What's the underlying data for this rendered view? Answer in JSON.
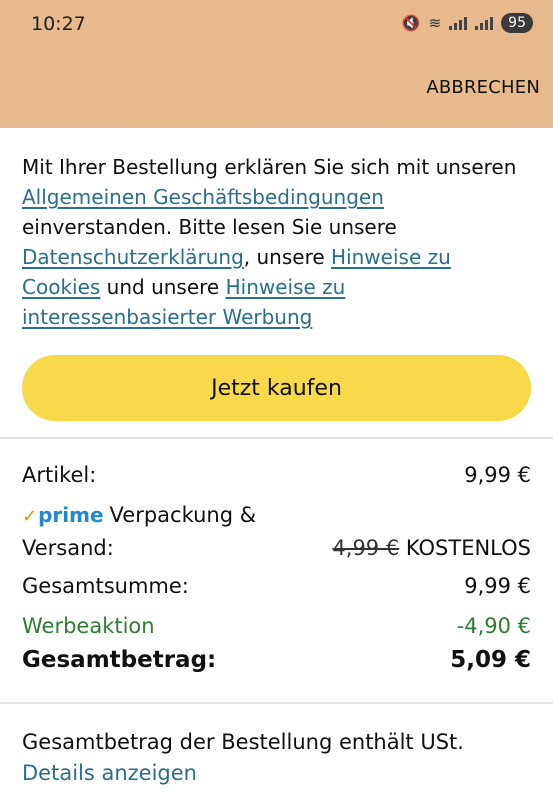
{
  "status_bar": {
    "time": "10:27",
    "battery": "95"
  },
  "header": {
    "cancel_label": "ABBRECHEN"
  },
  "legal": {
    "text1": "Mit Ihrer Bestellung erklären Sie sich mit unseren ",
    "link_terms": "Allgemeinen Geschäftsbedingungen",
    "text2": " einverstanden. Bitte lesen Sie unsere ",
    "link_privacy": "Datenschutzerklärung",
    "text3": ", unsere ",
    "link_cookies": "Hinweise zu Cookies",
    "text4": " und unsere ",
    "link_ads": "Hinweise zu interessenbasierter Werbung"
  },
  "buy_button": {
    "label": "Jetzt kaufen"
  },
  "summary": {
    "items_label": "Artikel:",
    "items_value": "9,99 €",
    "prime_label": "prime",
    "shipping_label_line1": "Verpackung &",
    "shipping_label_line2": "Versand:",
    "shipping_old": "4,99 €",
    "shipping_new": "KOSTENLOS",
    "subtotal_label": "Gesamtsumme:",
    "subtotal_value": "9,99 €",
    "promo_label": "Werbeaktion",
    "promo_value": "-4,90 €",
    "total_label": "Gesamtbetrag:",
    "total_value": "5,09 €"
  },
  "footer": {
    "vat_note": "Gesamtbetrag der Bestellung enthält USt.",
    "details_link": "Details anzeigen"
  },
  "colors": {
    "header_bg": "#e7b98c",
    "button_bg": "#f8d94a",
    "link": "#2a6f8c",
    "promo_green": "#2e7d32"
  }
}
